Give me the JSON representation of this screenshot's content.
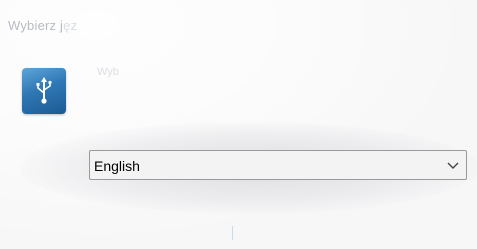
{
  "dialog": {
    "title": "Wybierz j",
    "title_fade": "ęz",
    "description": "Wyb",
    "app_icon": "usb-icon"
  },
  "language_select": {
    "selected": "English",
    "chevron_icon": "chevron-down-icon"
  },
  "colors": {
    "icon_blue": "#2f78b6",
    "select_border": "#9a9a9a"
  }
}
